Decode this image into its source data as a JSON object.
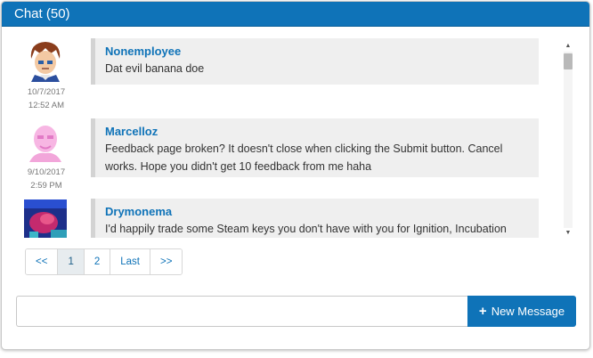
{
  "header": {
    "title": "Chat (50)"
  },
  "messages": [
    {
      "author": "Nonemployee",
      "text": "Dat evil banana doe",
      "date": "10/7/2017",
      "time": "12:52 AM"
    },
    {
      "author": "Marcelloz",
      "text": "Feedback page broken? It doesn't close when clicking the Submit button. Cancel works. Hope you didn't get 10 feedback from me haha",
      "date": "9/10/2017",
      "time": "2:59 PM"
    },
    {
      "author": "Drymonema",
      "text": "I'd happily trade some Steam keys you don't have with you for Ignition, Incubation",
      "date": "",
      "time": ""
    }
  ],
  "pagination": {
    "first": "<<",
    "p1": "1",
    "p2": "2",
    "last": "Last",
    "next": ">>"
  },
  "compose": {
    "placeholder": "",
    "button_label": "New Message",
    "button_icon": "plus-icon"
  },
  "colors": {
    "accent": "#0f73b8",
    "bubble": "#efefef"
  }
}
